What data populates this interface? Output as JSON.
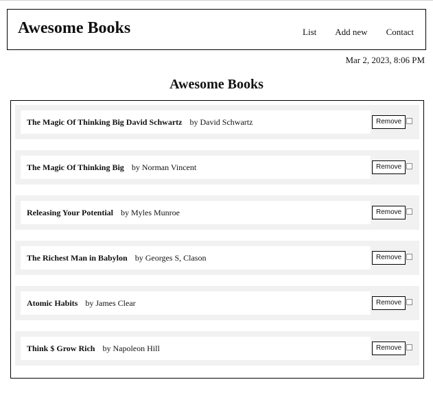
{
  "header": {
    "brand": "Awesome Books",
    "nav": {
      "list": "List",
      "add_new": "Add new",
      "contact": "Contact"
    }
  },
  "date": "Mar 2, 2023, 8:06 PM",
  "main": {
    "title": "Awesome Books",
    "remove_label": "Remove",
    "books": [
      {
        "title": "The Magic Of Thinking Big David Schwartz",
        "author": "by David Schwartz"
      },
      {
        "title": "The Magic Of Thinking Big",
        "author": "by Norman Vincent"
      },
      {
        "title": "Releasing Your Potential",
        "author": "by Myles Munroe"
      },
      {
        "title": "The Richest Man in Babylon",
        "author": "by Georges S, Clason"
      },
      {
        "title": "Atomic Habits",
        "author": "by James Clear"
      },
      {
        "title": "Think $ Grow Rich",
        "author": "by Napoleon Hill"
      }
    ]
  }
}
